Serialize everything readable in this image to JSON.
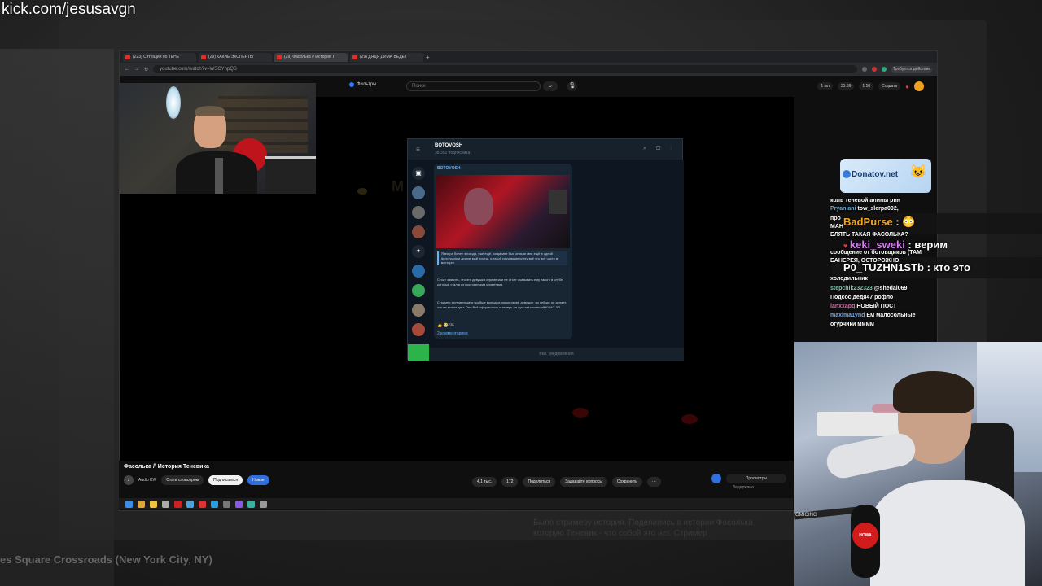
{
  "stream": {
    "url": "kick.com/jesusavgn"
  },
  "background_page": {
    "video_caption": "es Square Crossroads (New York City, NY)"
  },
  "browser": {
    "tabs": [
      {
        "label": "(223) Ситуации по ТЕНЕ"
      },
      {
        "label": "(29) КАКИЕ ЭКСПЕРТЫ"
      },
      {
        "label": "(29) Фасолька // История Т"
      },
      {
        "label": "(29) ДЯДЯ ДИМА ВЕДЕТ"
      }
    ],
    "address": "youtube.com/watch?v=WSCYhpQS",
    "profile_label": "Требуется действие"
  },
  "youtube": {
    "logo_text": "Фильтры",
    "search_placeholder": "Поиск",
    "search_icon": "search-icon",
    "mic_icon": "mic-icon",
    "header_pills": [
      "1 мл",
      "35:36",
      "1:58"
    ],
    "create_label": "Создать",
    "video_title": "Фасолька // История Теневика",
    "channel_name": "Audio KW",
    "channel_subs": "700 тыс. подписчиков",
    "sponsor_label": "Стать спонсором",
    "subscribe_label": "Подписаться",
    "notify_label": "Новое",
    "likes": "4,1 тыс.",
    "dislikes": "172",
    "share_label": "Поделиться",
    "ask_label": "Задавайте вопросы",
    "save_label": "Сохранить",
    "more_label": "···",
    "right_pill": "Просмотры",
    "right_sub": "Задержано"
  },
  "telegram": {
    "channel_name": "BOTOVOSH",
    "subscribers": "38 392 подписчика",
    "post_channel": "BOTOVOSH",
    "quote_text": "Я вчера более эпизода, уже ещё, когда мне был описан мне ещё в одной фотографии другие мой посещ, и такой случившиеся эту всё это всё часто в восторге",
    "body_text": "Стоит заявить, что это девушка стримера и не стоит оказывать ему такого в клубе, который стал в их постоянными клиентами.",
    "body_text_2": "Стример этот меньше и вообще молодых помог своей девушке, но сейчас он делает, что не может дать Она Всё оформилось и теперь он лучший котовщий КИНО ЭЛ",
    "reactions": "👍 😂 96",
    "comments_label": "2 комментариев",
    "views": "1.1k",
    "time": "19:30",
    "footer_label": "Вкл. уведомления",
    "menu_icon": "menu-icon",
    "sidebar_icons": [
      "archive-icon",
      "avatar-icon",
      "avatar-icon",
      "avatar-icon",
      "bot-icon",
      "avatar-icon",
      "avatar-icon",
      "avatar-icon",
      "avatar-icon"
    ]
  },
  "video_overlay": {
    "ghost_title": "M DUSTER"
  },
  "chat": {
    "donate_brand": "Donatov.net",
    "messages": [
      {
        "user": "",
        "text": "коль теневой алины рин"
      },
      {
        "user": "Pryaniani",
        "text": "tow_slerpa002,"
      },
      {
        "user": "",
        "text": "про"
      },
      {
        "user": "",
        "text": "МАН"
      },
      {
        "user": "",
        "text": "БЛЯТЬ ТАКАЯ ФАСОЛЬКА?"
      },
      {
        "user": "",
        "text": "сообщение от ботовщиков (ТАМ"
      },
      {
        "user": "",
        "text": "БАНЕРЕЯ, ОСТОРОЖНО!"
      },
      {
        "user": "",
        "text": "холодильник"
      },
      {
        "user": "stepchik232323",
        "text": "@shedal069"
      },
      {
        "user": "",
        "text": "Подсос дедя47 рофло"
      },
      {
        "user": "lanxxapq",
        "text": "НОВЫЙ ПОСТ"
      },
      {
        "user": "maxima1ynd",
        "text": "Ем малосольные"
      },
      {
        "user": "",
        "text": "огурчики мммм"
      }
    ],
    "big_messages": [
      {
        "user": "BadPurse",
        "sep": " : ",
        "text": "😳",
        "color": "#f5a623"
      },
      {
        "user": "keki_sweki",
        "sep": " : ",
        "text": "верим",
        "color": "#d87cf5"
      },
      {
        "user": "P0_TUZHN1STb",
        "sep": " : ",
        "text": "кто это",
        "color": "#ffffff"
      }
    ]
  },
  "webcam": {
    "mic_sign": "HOWA",
    "label": "GMIOING"
  },
  "bg_description": "Было стримеру история. Поделились в истории Фасолька которую Теневик - что собой это нет. Стример"
}
